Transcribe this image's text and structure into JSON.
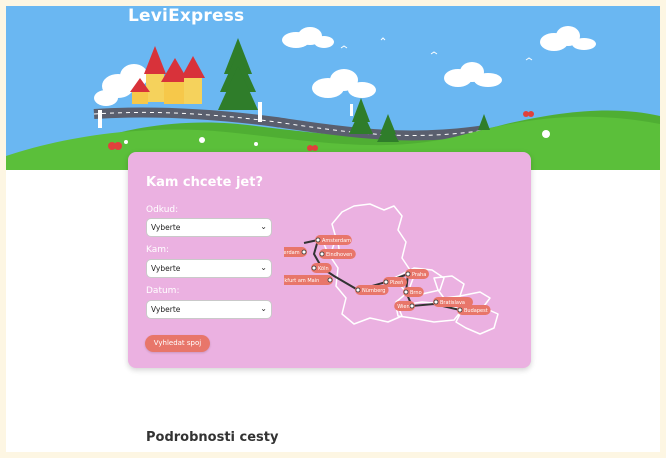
{
  "brand": {
    "name": "LeviExpress"
  },
  "search": {
    "title": "Kam chcete jet?",
    "from_label": "Odkud:",
    "from_value": "Vyberte",
    "to_label": "Kam:",
    "to_value": "Vyberte",
    "date_label": "Datum:",
    "date_value": "Vyberte",
    "button_label": "Vyhledat spoj"
  },
  "route_map": {
    "cities": [
      "Amsterdam",
      "Rotterdam",
      "Eindhoven",
      "Köln",
      "Frankfurt am Main",
      "Nürnberg",
      "Plzeň",
      "Praha",
      "Brno",
      "Wien",
      "Bratislava",
      "Budapest"
    ]
  },
  "details": {
    "title": "Podrobnosti cesty"
  },
  "colors": {
    "sky": "#6ab7f2",
    "card": "#ebb1e1",
    "accent": "#e8766a",
    "grass": "#5bbf3a"
  }
}
